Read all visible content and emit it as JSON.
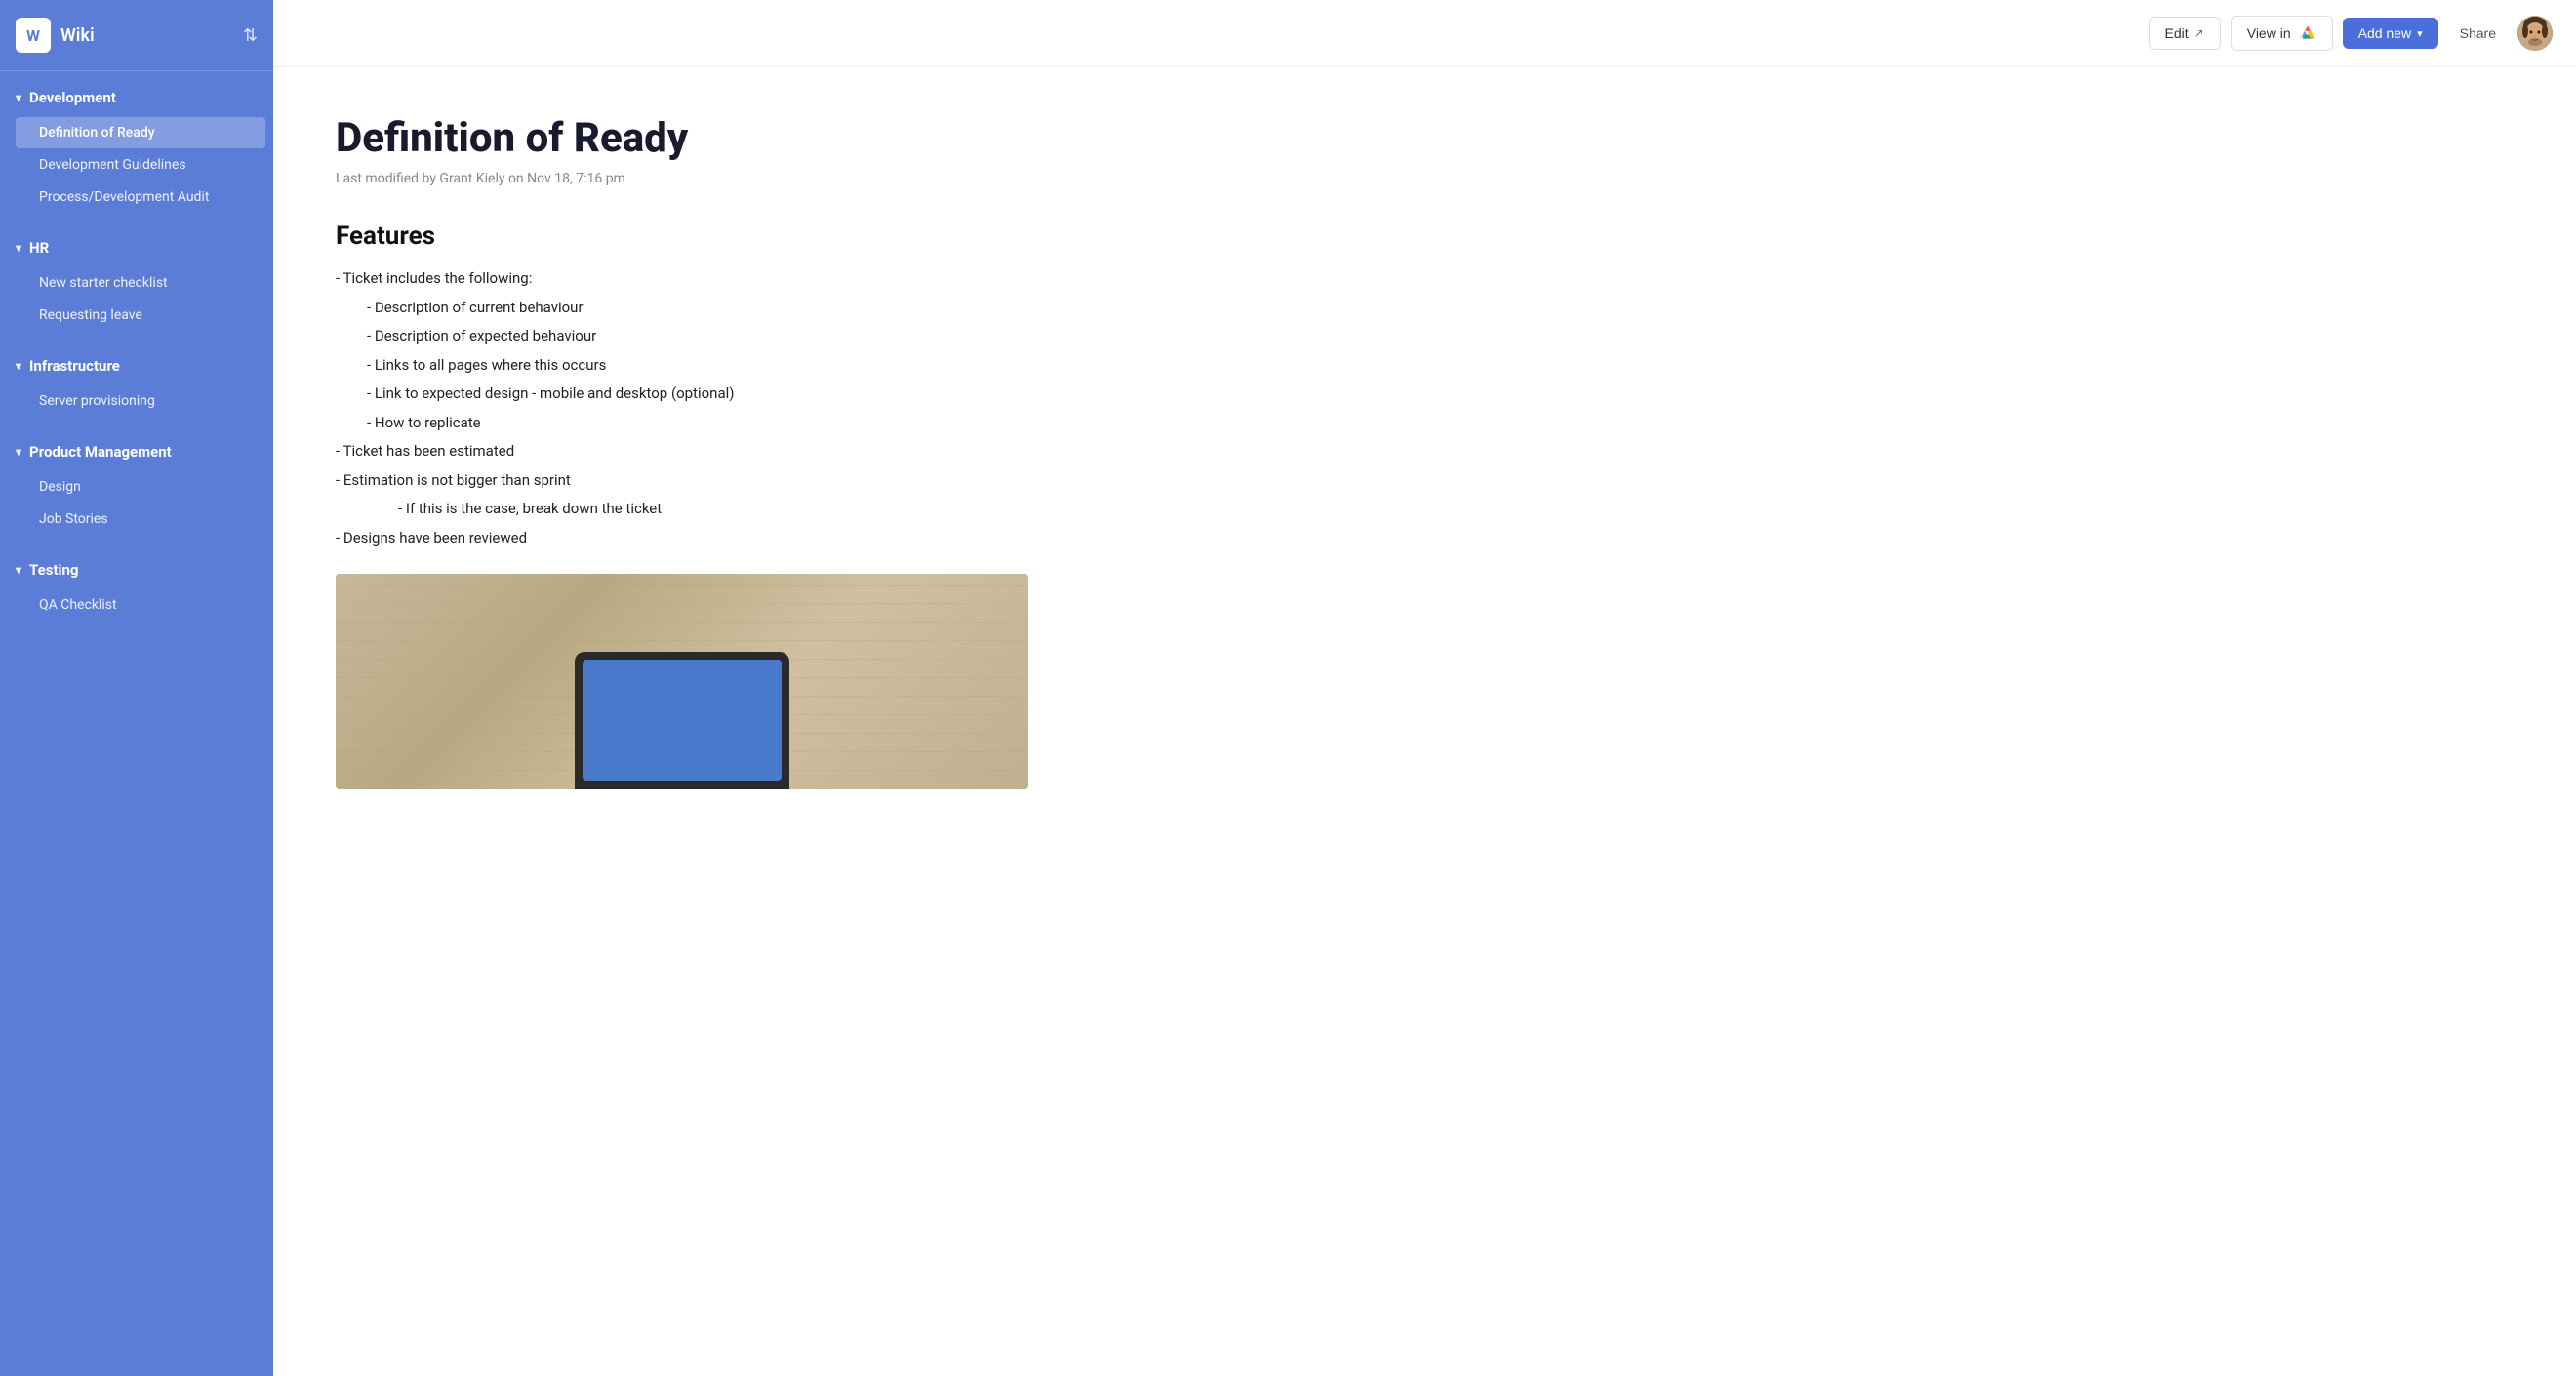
{
  "sidebar": {
    "logo_letter": "W",
    "logo_text": "Wiki",
    "sections": [
      {
        "id": "development",
        "label": "Development",
        "expanded": true,
        "items": [
          {
            "id": "definition-of-ready",
            "label": "Definition of Ready",
            "active": true
          },
          {
            "id": "development-guidelines",
            "label": "Development Guidelines",
            "active": false
          },
          {
            "id": "process-development-audit",
            "label": "Process/Development Audit",
            "active": false
          }
        ]
      },
      {
        "id": "hr",
        "label": "HR",
        "expanded": true,
        "items": [
          {
            "id": "new-starter-checklist",
            "label": "New starter checklist",
            "active": false
          },
          {
            "id": "requesting-leave",
            "label": "Requesting leave",
            "active": false
          }
        ]
      },
      {
        "id": "infrastructure",
        "label": "Infrastructure",
        "expanded": true,
        "items": [
          {
            "id": "server-provisioning",
            "label": "Server provisioning",
            "active": false
          }
        ]
      },
      {
        "id": "product-management",
        "label": "Product Management",
        "expanded": true,
        "items": [
          {
            "id": "design",
            "label": "Design",
            "active": false
          },
          {
            "id": "job-stories",
            "label": "Job Stories",
            "active": false
          }
        ]
      },
      {
        "id": "testing",
        "label": "Testing",
        "expanded": true,
        "items": [
          {
            "id": "qa-checklist",
            "label": "QA Checklist",
            "active": false
          }
        ]
      }
    ]
  },
  "topbar": {
    "edit_label": "Edit",
    "view_in_label": "View in",
    "add_new_label": "Add new",
    "share_label": "Share"
  },
  "page": {
    "title": "Definition of Ready",
    "meta": "Last modified by Grant Kiely on Nov 18, 7:16 pm",
    "features_heading": "Features",
    "content": {
      "line1": "- Ticket includes the following:",
      "line2": "- Description of current behaviour",
      "line3": "- Description of expected behaviour",
      "line4": "- Links to all pages where this occurs",
      "line5": "- Link to expected design - mobile and desktop (optional)",
      "line6": "- How to replicate",
      "line7": "- Ticket has been estimated",
      "line8": "- Estimation is not bigger than sprint",
      "line9": "- If this is the case, break down the ticket",
      "line10": "- Designs have been reviewed"
    }
  }
}
